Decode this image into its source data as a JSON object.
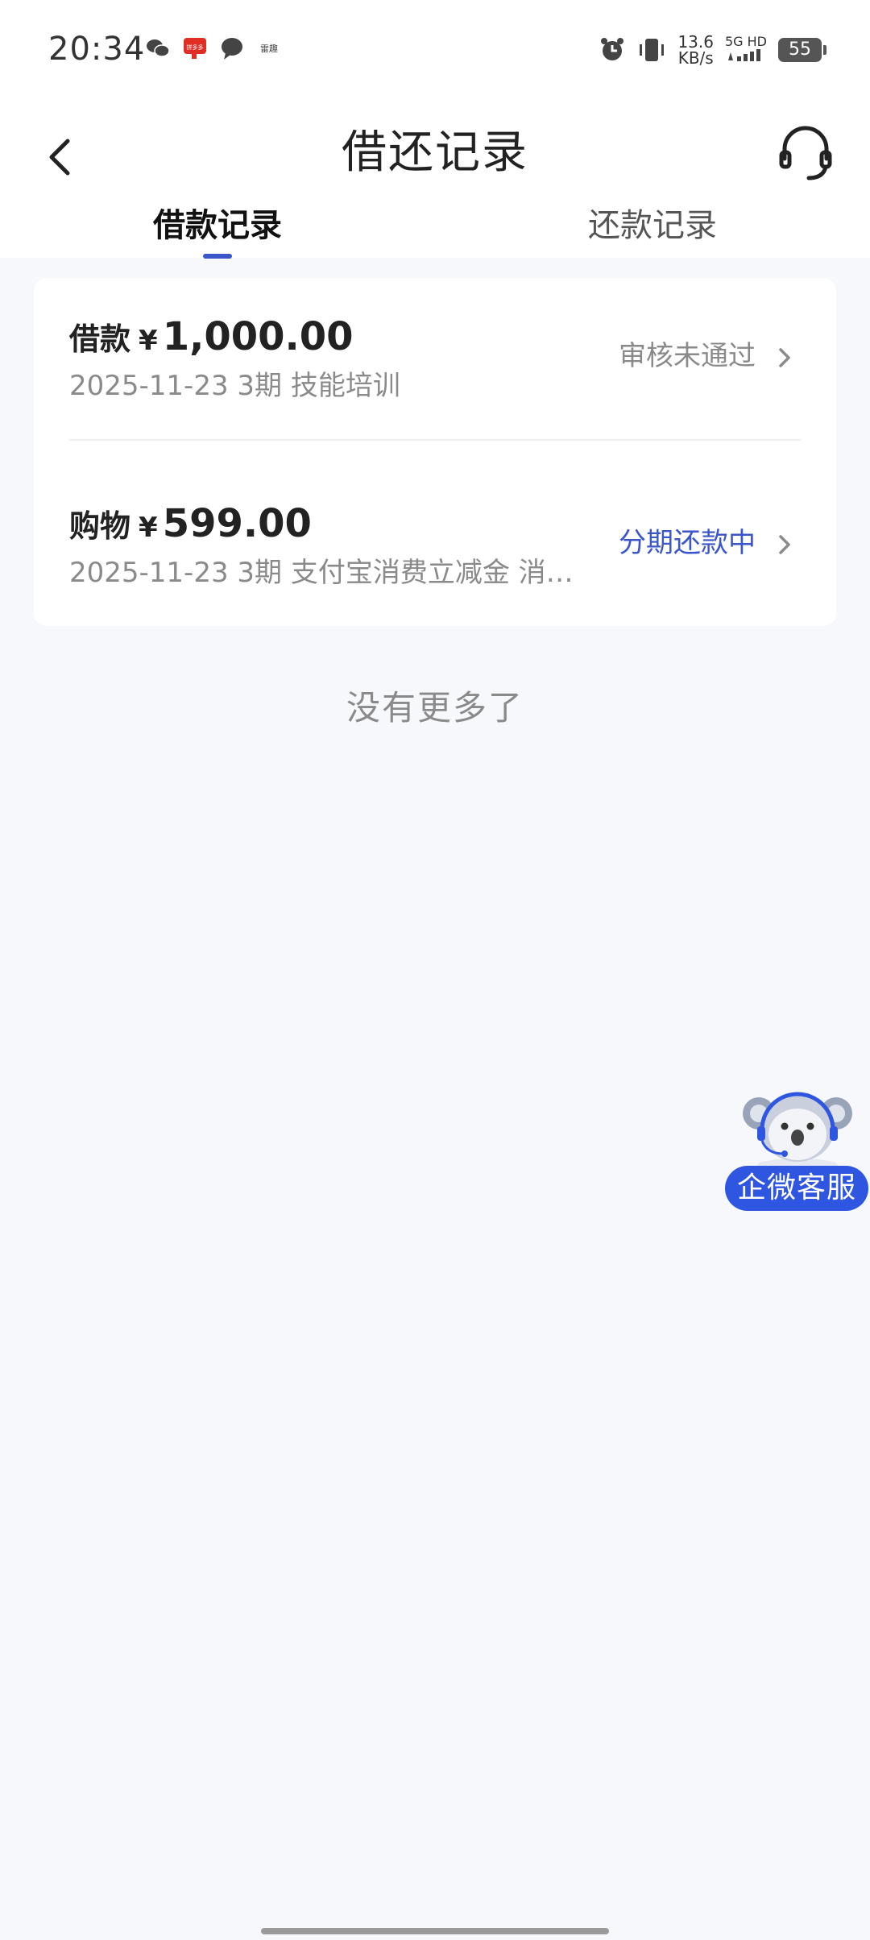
{
  "status_bar": {
    "time": "20:34",
    "notif_badge_text": "拼多多",
    "leiqu_text": "雷趣",
    "speed_top": "13.6",
    "speed_bottom": "KB/s",
    "net_top": "5G HD",
    "battery": "55",
    "icons": [
      "wechat-icon",
      "pinduoduo-icon",
      "message-icon",
      "leiqu-icon",
      "alarm-icon",
      "vibrate-icon",
      "signal-icon",
      "battery-icon"
    ]
  },
  "header": {
    "title": "借还记录",
    "back_icon": "chevron-left-icon",
    "service_icon": "headset-icon"
  },
  "tabs": [
    {
      "label": "借款记录",
      "active": true
    },
    {
      "label": "还款记录",
      "active": false
    }
  ],
  "records": [
    {
      "type": "借款",
      "currency": "¥",
      "amount": "1,000.00",
      "subtitle": "2025-11-23 3期  技能培训",
      "status": "审核未通过",
      "status_color": "#8a8a8a"
    },
    {
      "type": "购物",
      "currency": "¥",
      "amount": "599.00",
      "subtitle": "2025-11-23 3期  支付宝消费立减金 消…",
      "status": "分期还款中",
      "status_color": "#3a56c8"
    }
  ],
  "no_more": "没有更多了",
  "float_service": {
    "label": "企微客服",
    "color": "#2f56e0"
  },
  "accent": "#3a56c8"
}
